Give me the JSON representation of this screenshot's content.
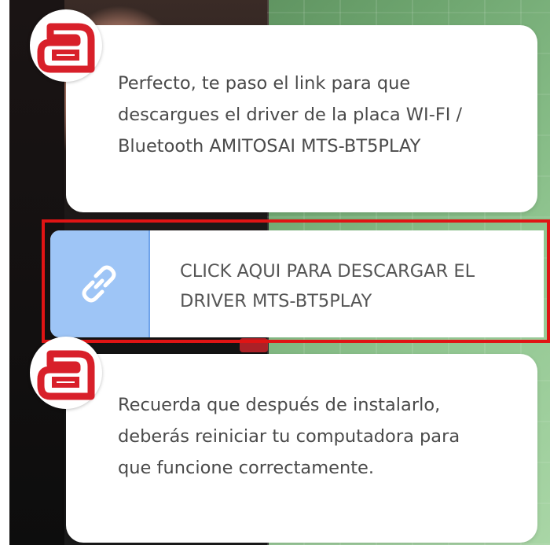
{
  "messages": [
    {
      "text": "Perfecto, te paso el link para que descargues el driver de la placa WI-FI / Bluetooth AMITOSAI MTS-BT5PLAY"
    },
    {
      "text": "Recuerda que después de instalarlo, deberás reiniciar tu computadora para que funcione correctamente."
    }
  ],
  "link_card": {
    "icon": "link-icon",
    "label": "CLICK AQUI PARA DESCARGAR EL DRIVER MTS-BT5PLAY"
  },
  "avatar": {
    "icon": "brand-a-logo-icon",
    "letter": "a"
  },
  "colors": {
    "highlight_frame": "#e01414",
    "link_icon_bg": "#9ec5f6",
    "avatar_red": "#d8202a"
  }
}
